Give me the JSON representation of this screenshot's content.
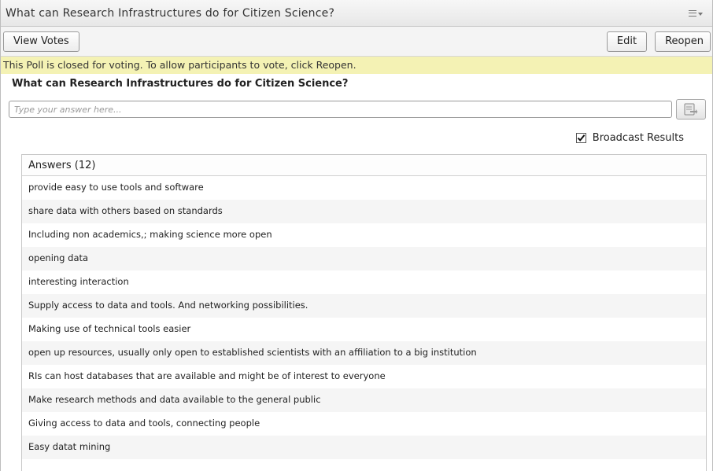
{
  "window": {
    "title": "What can Research Infrastructures do for Citizen Science?",
    "menu_icon": "hamburger-menu-icon"
  },
  "toolbar": {
    "view_votes_label": "View Votes",
    "edit_label": "Edit",
    "reopen_label": "Reopen"
  },
  "notice": {
    "text": "This Poll is closed for voting. To allow participants to vote, click Reopen.",
    "color": "#f4f2b4"
  },
  "poll": {
    "question": "What can Research Infrastructures do for Citizen Science?",
    "answer_placeholder": "Type your answer here...",
    "answer_value": "",
    "submit_icon": "submit-answer-icon"
  },
  "broadcast": {
    "label": "Broadcast Results",
    "checked": true
  },
  "answers": {
    "header": "Answers (12)",
    "items": [
      "provide easy to use tools and software",
      "share data with others based on standards",
      "Including non academics,; making science more open",
      "opening data",
      "interesting interaction",
      "Supply access to data and tools. And networking possibilities.",
      "Making use of technical tools easier",
      "open up resources, usually only open to established scientists with an affiliation to a big institution",
      "RIs can host databases that are available and might be of interest to everyone",
      "Make research methods and data available to the general public",
      "Giving access to data and tools, connecting people",
      "Easy datat mining"
    ]
  }
}
